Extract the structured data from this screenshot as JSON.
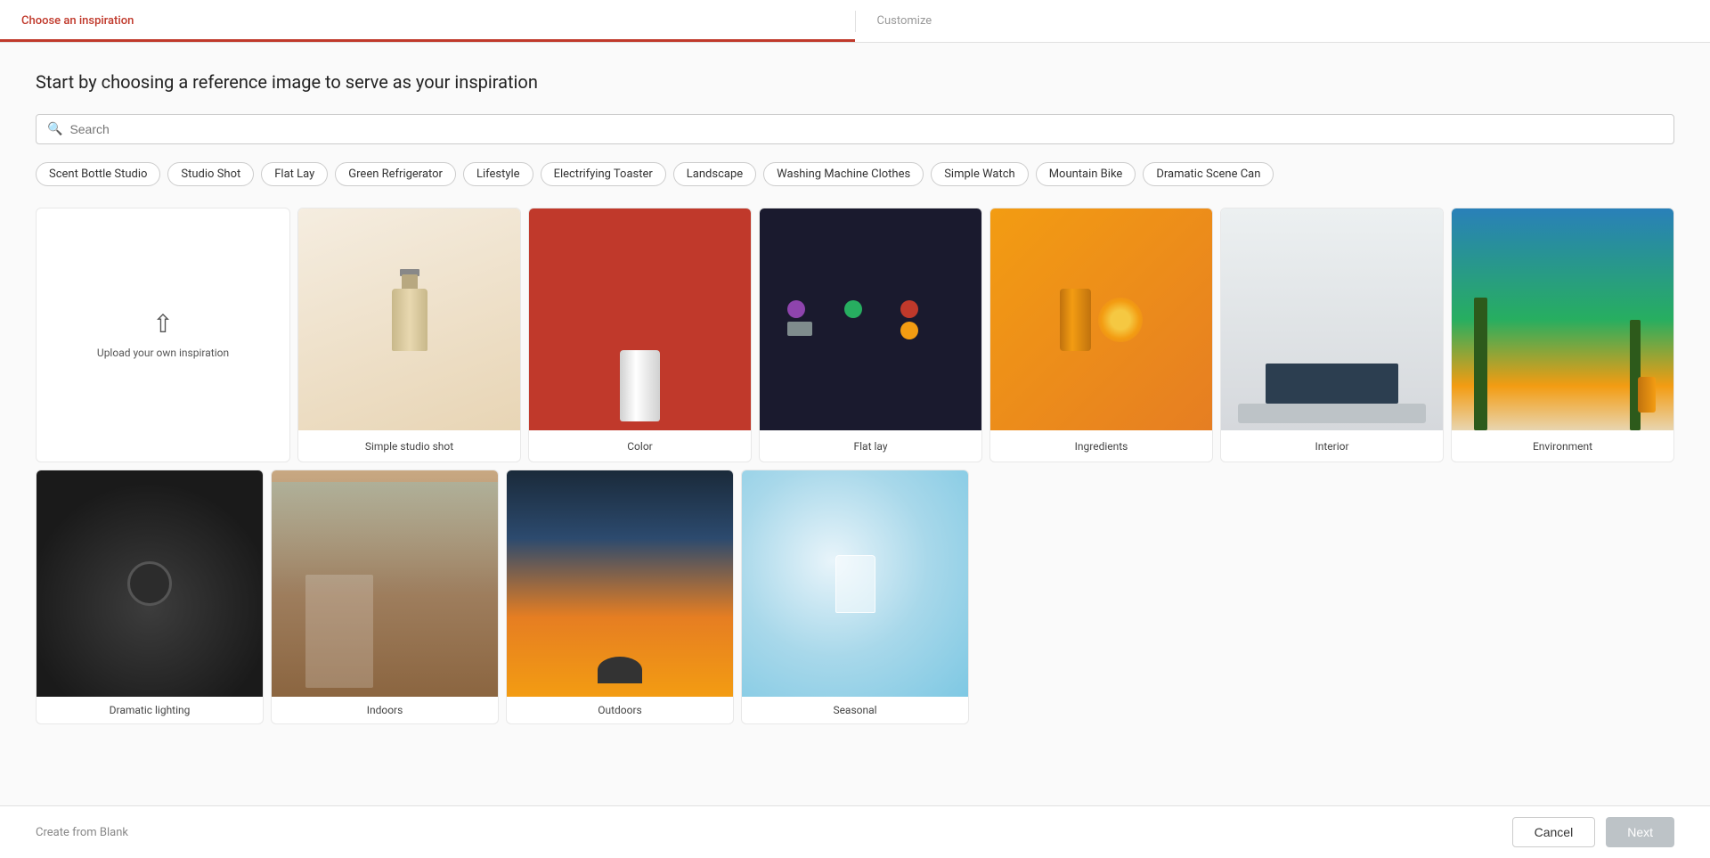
{
  "nav": {
    "step1_label": "Choose an inspiration",
    "step2_label": "Customize"
  },
  "page": {
    "title": "Start by choosing a reference image to serve as your inspiration"
  },
  "search": {
    "placeholder": "Search"
  },
  "chips": [
    "Scent Bottle Studio",
    "Studio Shot",
    "Flat Lay",
    "Green Refrigerator",
    "Lifestyle",
    "Electrifying Toaster",
    "Landscape",
    "Washing Machine Clothes",
    "Simple Watch",
    "Mountain Bike",
    "Dramatic Scene Can"
  ],
  "upload": {
    "icon": "↑",
    "text": "Upload your own inspiration"
  },
  "grid_row1": [
    {
      "id": "simple-studio-shot",
      "label": "Simple studio shot",
      "style": "studio"
    },
    {
      "id": "color",
      "label": "Color",
      "style": "color"
    },
    {
      "id": "flat-lay",
      "label": "Flat lay",
      "style": "flat"
    },
    {
      "id": "ingredients",
      "label": "Ingredients",
      "style": "ingredients"
    },
    {
      "id": "interior",
      "label": "Interior",
      "style": "interior"
    },
    {
      "id": "environment",
      "label": "Environment",
      "style": "environment"
    }
  ],
  "grid_row2": [
    {
      "id": "dramatic-lighting",
      "label": "Dramatic lighting",
      "style": "dramatic"
    },
    {
      "id": "indoors",
      "label": "Indoors",
      "style": "indoors"
    },
    {
      "id": "outdoors",
      "label": "Outdoors",
      "style": "outdoors"
    },
    {
      "id": "seasonal",
      "label": "Seasonal",
      "style": "seasonal"
    }
  ],
  "footer": {
    "create_from_blank": "Create from Blank",
    "cancel_label": "Cancel",
    "next_label": "Next"
  }
}
